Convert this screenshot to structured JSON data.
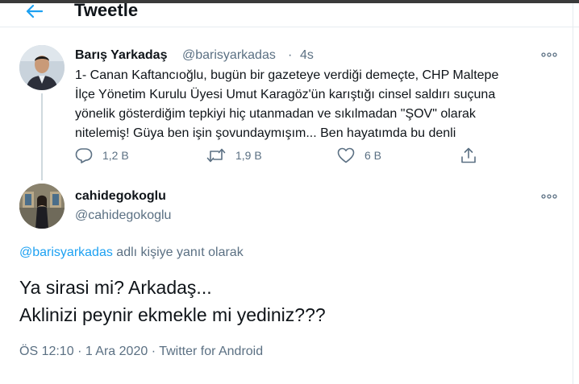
{
  "header": {
    "title": "Tweetle"
  },
  "parent_tweet": {
    "author_name": "Barış Yarkadaş",
    "author_handle": "@barisyarkadas",
    "separator": "·",
    "time": "4s",
    "text_lines": [
      "1- Canan Kaftancıoğlu, bugün bir gazeteye verdiği demeçte, CHP Maltepe",
      "İlçe Yönetim Kurulu Üyesi Umut Karagöz'ün karıştığı cinsel saldırı suçuna",
      "yönelik gösterdiğim tepkiyi hiç utanmadan ve sıkılmadan \"ŞOV\" olarak",
      "nitelemiş! Güya ben işin şovundaymışım... Ben hayatımda bu denli"
    ],
    "reply_count": "1,2 B",
    "retweet_count": "1,9 B",
    "like_count": "6 B"
  },
  "main_tweet": {
    "author_name": "cahidegokoglu",
    "author_handle": "@cahidegokoglu",
    "replying_handle": "@barisyarkadas",
    "replying_suffix": " adlı kişiye yanıt olarak",
    "text_lines": [
      "Ya sirasi mi? Arkadaş...",
      "Aklinizi peynir ekmekle mi yediniz???"
    ],
    "time": "ÖS 12:10",
    "date": "1 Ara 2020",
    "dot": "·",
    "source": "Twitter for Android"
  },
  "colors": {
    "accent": "#1da1f2",
    "secondary_text": "#5b7083",
    "primary_text": "#0f1419"
  },
  "icons": {
    "back": "arrow-left-icon",
    "more": "more-horizontal-icon",
    "reply": "reply-icon",
    "retweet": "retweet-icon",
    "like": "heart-icon",
    "share": "share-icon"
  }
}
